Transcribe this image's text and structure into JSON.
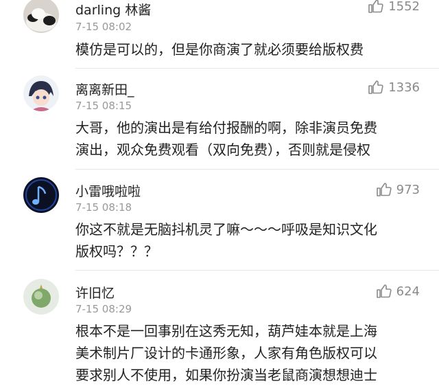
{
  "comments": [
    {
      "name": "darling 林酱",
      "time": "7-15 08:02",
      "likes": "1552",
      "text": "模仿是可以的，但是你商演了就必须要给版权费",
      "avatar_icon": "panda-avatar"
    },
    {
      "name": "离离新田_",
      "time": "7-15 08:15",
      "likes": "1336",
      "text": "大哥，他的演出是有给付报酬的啊，除非演员免费\n演出，观众免费观看（双向免费），否则就是侵权",
      "avatar_icon": "anime-boy-avatar"
    },
    {
      "name": "小雷哦啦啦",
      "time": "7-15 08:18",
      "likes": "973",
      "text": "你这不就是无脑抖机灵了嘛～～～呼吸是知识文化\n版权吗？？？",
      "avatar_icon": "music-note-avatar"
    },
    {
      "name": "许旧忆",
      "time": "7-15 08:29",
      "likes": "624",
      "text": "根本不是一回事别在这秀无知，葫芦娃本就是上海\n美术制片厂设计的卡通形象，人家有角色版权可以\n要求别人不使用，如果你扮演当老鼠商演想想迪士",
      "avatar_icon": "globe-avatar"
    }
  ],
  "colors": {
    "text": "#222222",
    "meta": "#9a9a9a",
    "like": "#8a8a8a",
    "divider": "#e6e6e6"
  }
}
